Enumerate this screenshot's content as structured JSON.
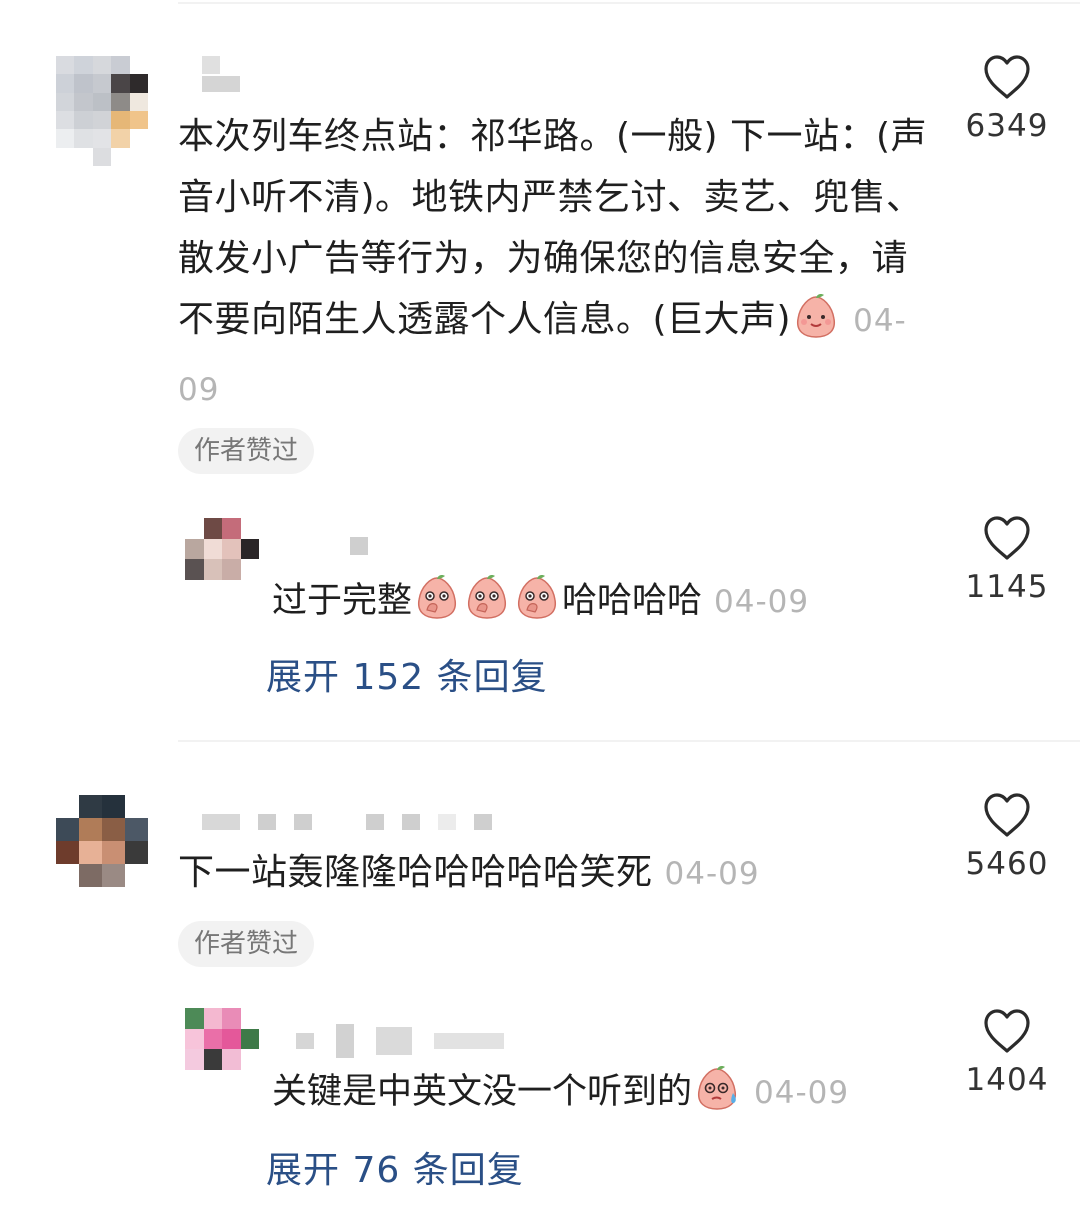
{
  "comments": [
    {
      "text": "本次列车终点站：祁华路。(一般) 下一站：(声音小听不清)。地铁内严禁乞讨、卖艺、兜售、散发小广告等行为，为确保您的信息安全，请不要向陌生人透露个人信息。(巨大声)",
      "date": "04-09",
      "likes": "6349",
      "badge": "作者赞过",
      "reply": {
        "text": "过于完整",
        "text_after": "哈哈哈哈",
        "date": "04-09",
        "likes": "1145"
      },
      "expand_label": "展开 152 条回复"
    },
    {
      "text": "下一站轰隆隆哈哈哈哈哈笑死",
      "date": "04-09",
      "likes": "5460",
      "badge": "作者赞过",
      "reply": {
        "text": "关键是中英文没一个听到的",
        "date": "04-09",
        "likes": "1404"
      },
      "expand_label": "展开 76 条回复"
    }
  ],
  "icons": {
    "like": "heart-outline-icon",
    "emoji_smile": "peach-smile-emoji",
    "emoji_shy": "peach-cover-mouth-emoji",
    "emoji_sweat": "peach-sweat-emoji"
  },
  "colors": {
    "link": "#2a4f86",
    "date": "#b5b5b5",
    "badge_bg": "#f2f2f2"
  }
}
